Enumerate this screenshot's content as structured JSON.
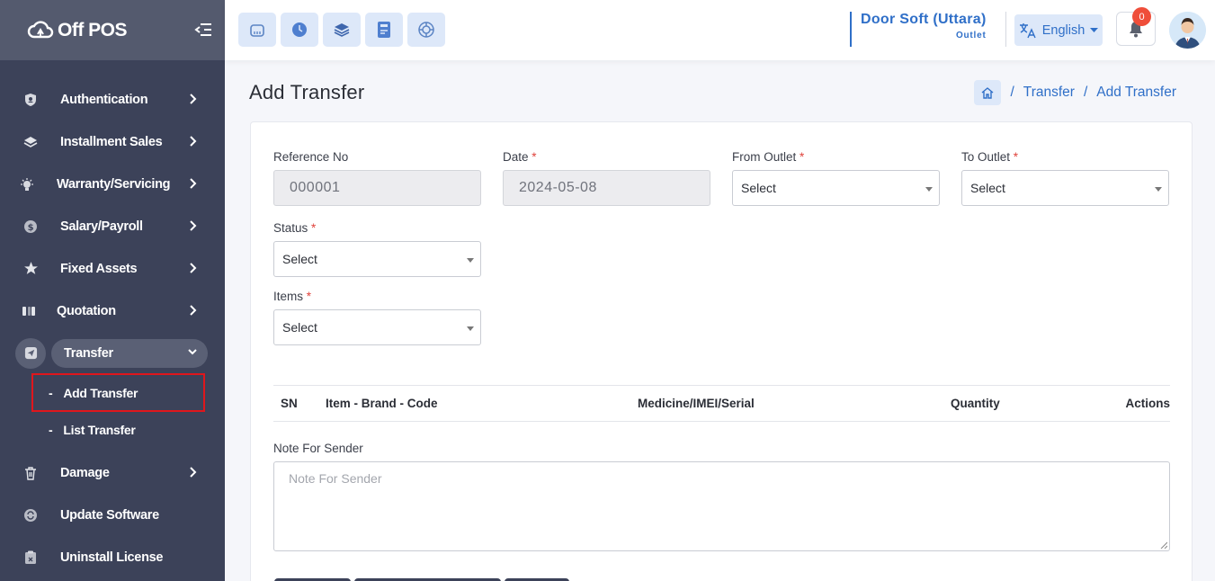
{
  "app": {
    "logo_text": "Off POS"
  },
  "sidebar": {
    "items": [
      {
        "label": "Authentication",
        "icon": "shield-user-icon"
      },
      {
        "label": "Installment Sales",
        "icon": "layers-icon"
      },
      {
        "label": "Warranty/Servicing",
        "icon": "bulb-icon"
      },
      {
        "label": "Salary/Payroll",
        "icon": "dollar-coin-icon"
      },
      {
        "label": "Fixed Assets",
        "icon": "star-icon"
      },
      {
        "label": "Quotation",
        "icon": "quote-icon"
      },
      {
        "label": "Transfer",
        "icon": "send-icon"
      },
      {
        "label": "Damage",
        "icon": "trash-icon"
      },
      {
        "label": "Update Software",
        "icon": "refresh-icon"
      },
      {
        "label": "Uninstall License",
        "icon": "uninstall-icon"
      }
    ],
    "sub_items": [
      {
        "label": "Add Transfer"
      },
      {
        "label": "List Transfer"
      }
    ]
  },
  "header": {
    "store_name": "Door Soft (Uttara)",
    "store_sub": "Outlet",
    "language": "English",
    "notification_count": "0",
    "accent": "#2f6fc8"
  },
  "page": {
    "title": "Add Transfer",
    "breadcrumb": [
      "Transfer",
      "Add Transfer"
    ]
  },
  "form": {
    "reference_label": "Reference No",
    "reference_value": "000001",
    "date_label": "Date",
    "date_value": "2024-05-08",
    "from_outlet_label": "From Outlet",
    "from_outlet_value": "Select",
    "to_outlet_label": "To Outlet",
    "to_outlet_value": "Select",
    "status_label": "Status",
    "status_value": "Select",
    "items_label": "Items",
    "items_value": "Select",
    "required_mark": "*"
  },
  "table": {
    "headers": [
      "SN",
      "Item - Brand - Code",
      "Medicine/IMEI/Serial",
      "Quantity",
      "Actions"
    ]
  },
  "note": {
    "label": "Note For Sender",
    "placeholder": "Note For Sender"
  }
}
